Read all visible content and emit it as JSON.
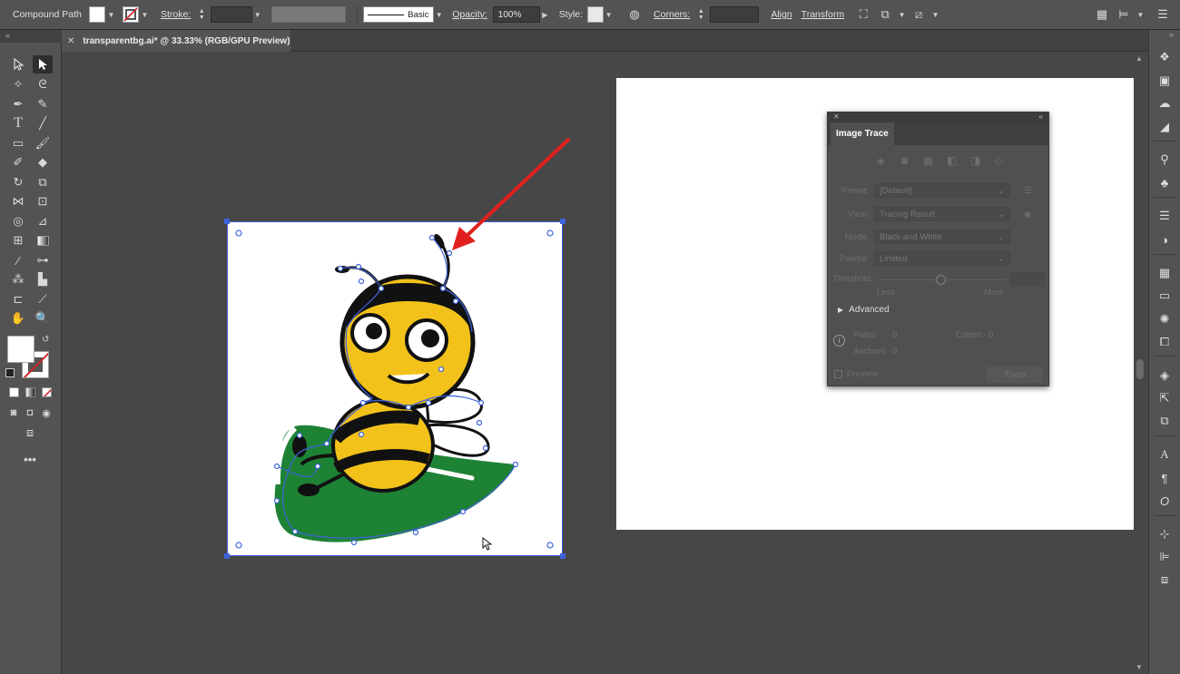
{
  "control_bar": {
    "selection_type": "Compound Path",
    "stroke_label": "Stroke:",
    "stroke_style": "Basic",
    "opacity_label": "Opacity:",
    "opacity_value": "100%",
    "style_label": "Style:",
    "corners_label": "Corners:",
    "align_label": "Align",
    "transform_label": "Transform"
  },
  "document": {
    "tab_title": "transparentbg.ai* @ 33.33% (RGB/GPU Preview)"
  },
  "colors": {
    "bee_yellow": "#f2c21a",
    "leaf_green": "#1e8235",
    "selection_blue": "#3e63d9",
    "arrow_red": "#e0201e"
  },
  "image_trace": {
    "title": "Image Trace",
    "preset_label": "Preset:",
    "preset_value": "[Default]",
    "view_label": "View:",
    "view_value": "Tracing Result",
    "mode_label": "Mode:",
    "mode_value": "Black and White",
    "palette_label": "Palette:",
    "palette_value": "Limited",
    "threshold_label": "Threshold:",
    "less_label": "Less",
    "more_label": "More",
    "advanced_label": "Advanced",
    "paths_label": "Paths:",
    "paths_value": "0",
    "colors_label": "Colors:",
    "colors_value": "0",
    "anchors_label": "Anchors:",
    "anchors_value": "0",
    "preview_label": "Preview",
    "trace_button": "Trace"
  }
}
